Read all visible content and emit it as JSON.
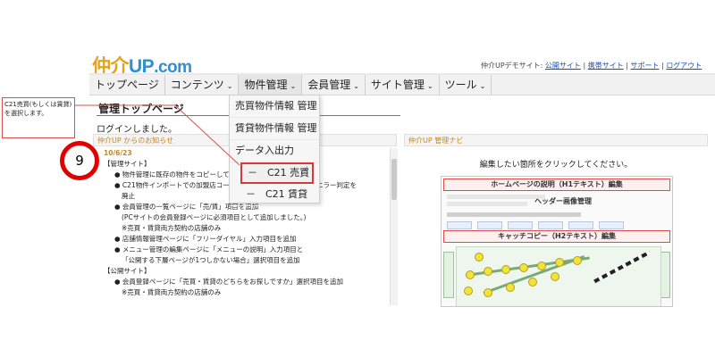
{
  "header": {
    "logo_jp": "仲介",
    "logo_up": "UP",
    "logo_com": ".com",
    "site_prefix": "仲介UPデモサイト:",
    "links": [
      "公開サイト",
      "携帯サイト",
      "サポート",
      "ログアウト"
    ],
    "separator": "|"
  },
  "nav": {
    "items": [
      {
        "label": "トップページ"
      },
      {
        "label": "コンテンツ"
      },
      {
        "label": "物件管理"
      },
      {
        "label": "会員管理"
      },
      {
        "label": "サイト管理"
      },
      {
        "label": "ツール"
      }
    ],
    "chevron": "⌄"
  },
  "dropdown": {
    "items": [
      "売買物件情報 管理",
      "賃貸物件情報 管理",
      "データ入出力",
      "－　C21 売買",
      "－　C21 賃貸"
    ]
  },
  "main": {
    "title": "管理トップページ",
    "login_message": "ログインしました。"
  },
  "news": {
    "heading": "仲介UP からのお知らせ",
    "date": "10/6/23",
    "lines": [
      {
        "cls": "sec",
        "text": "【管理サイト】"
      },
      {
        "cls": "li",
        "text": "● 物件管理に既存の物件をコピーして"
      },
      {
        "cls": "li",
        "text": "● C21物件インポートでの加盟店コー　　　　　　　　　　によるエラー判定を"
      },
      {
        "cls": "li2",
        "text": "廃止"
      },
      {
        "cls": "li",
        "text": "● 会員管理の一覧ページに「売/賃」項目を追加"
      },
      {
        "cls": "li2",
        "text": "(PCサイトの会員登録ページに必須項目として追加しました。)"
      },
      {
        "cls": "li2",
        "text": "※売買・賃貸両方契約の店舗のみ"
      },
      {
        "cls": "li",
        "text": "● 店舗情報管理ページに「フリーダイヤル」入力項目を追加"
      },
      {
        "cls": "li",
        "text": "● メニュー管理の編集ページに「メニューの説明」入力項目と"
      },
      {
        "cls": "li2",
        "text": "「公開する下層ページが1つしかない場合」選択項目を追加"
      },
      {
        "cls": "sec",
        "text": "【公開サイト】"
      },
      {
        "cls": "li",
        "text": "● 会員登録ページに「売買・賃貸のどちらをお探しですか」選択項目を追加"
      },
      {
        "cls": "li2",
        "text": "※売買・賃貸両方契約の店舗のみ"
      }
    ]
  },
  "navi": {
    "heading": "仲介UP 管理ナビ",
    "prompt": "編集したい箇所をクリックしてください。",
    "bar1": "ホームページの説明（H1テキスト）編集",
    "header_label": "ヘッダー画像管理",
    "bar2": "キャッチコピー（H2テキスト）編集"
  },
  "annotation": {
    "callout": "C21売買(もしくは賃貸)を選択します。",
    "step": "9"
  },
  "colors": {
    "accent_orange": "#e8a21a",
    "accent_blue": "#2f8fd2",
    "highlight_red": "#d63a3a",
    "step_red": "#e00000"
  }
}
